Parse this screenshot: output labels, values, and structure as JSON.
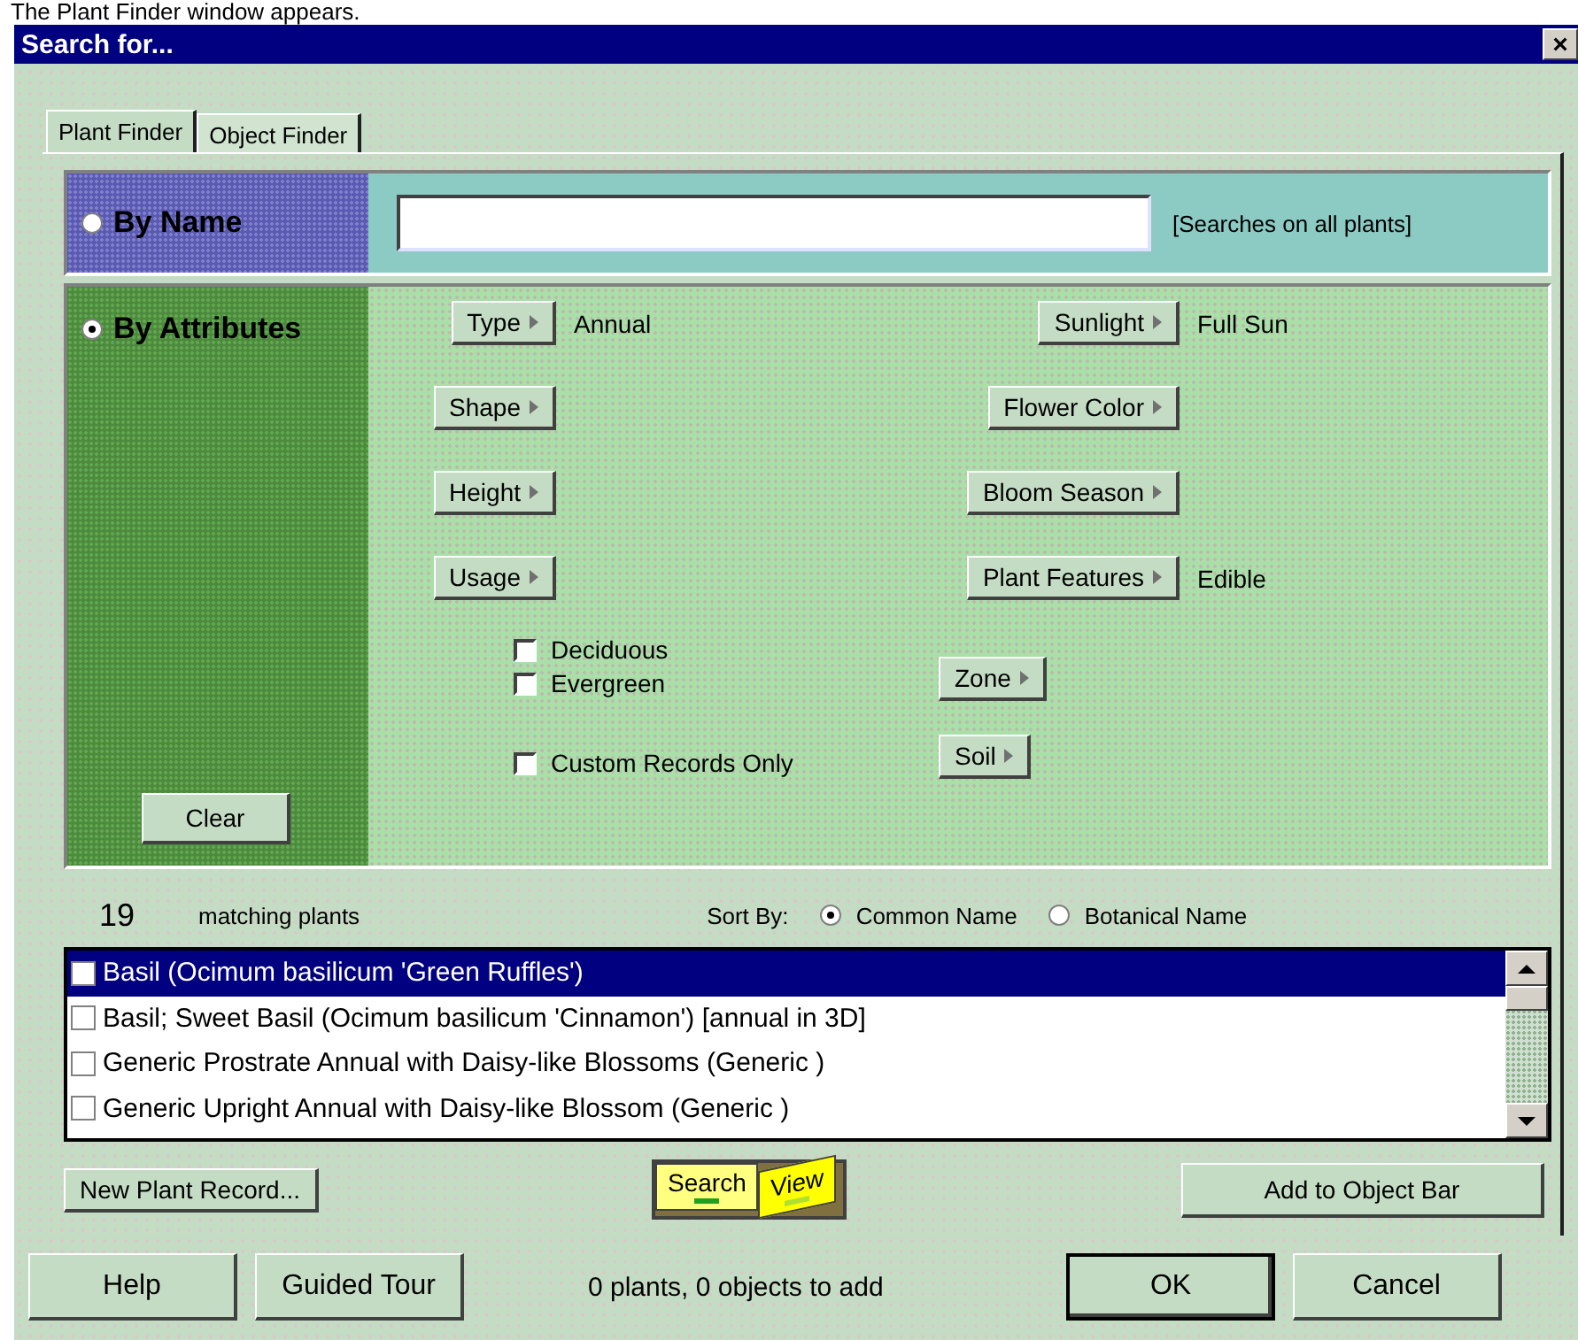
{
  "caption": "The Plant Finder window appears.",
  "window": {
    "title": "Search for...",
    "close": "×"
  },
  "tabs": [
    {
      "label": "Plant Finder",
      "selected": true
    },
    {
      "label": "Object Finder",
      "selected": false
    }
  ],
  "by_name": {
    "label": "By Name",
    "selected": false,
    "hint": "[Searches on all plants]"
  },
  "by_attributes": {
    "label": "By Attributes",
    "selected": true,
    "attributes": [
      {
        "label": "Type",
        "value": "Annual"
      },
      {
        "label": "Sunlight",
        "value": "Full Sun"
      },
      {
        "label": "Shape"
      },
      {
        "label": "Flower Color"
      },
      {
        "label": "Height"
      },
      {
        "label": "Bloom Season"
      },
      {
        "label": "Usage"
      },
      {
        "label": "Plant Features",
        "value": "Edible"
      }
    ],
    "checkboxes": [
      {
        "label": "Deciduous",
        "checked": false
      },
      {
        "label": "Evergreen",
        "checked": false
      },
      {
        "label": "Custom Records Only",
        "checked": false
      }
    ],
    "more_buttons": [
      "Zone",
      "Soil"
    ],
    "clear": "Clear"
  },
  "results": {
    "count": "19",
    "count_label": "matching plants",
    "sort_label": "Sort By:",
    "sort_options": [
      {
        "label": "Common Name",
        "selected": true
      },
      {
        "label": "Botanical Name",
        "selected": false
      }
    ]
  },
  "plants": [
    {
      "name": "Basil (Ocimum basilicum 'Green Ruffles')",
      "selected": true,
      "checked": false
    },
    {
      "name": "Basil; Sweet Basil (Ocimum basilicum 'Cinnamon') [annual in 3D]",
      "selected": false,
      "checked": false
    },
    {
      "name": "Generic Prostrate Annual with Daisy-like Blossoms (Generic )",
      "selected": false,
      "checked": false
    },
    {
      "name": "Generic Upright Annual with Daisy-like Blossom (Generic )",
      "selected": false,
      "checked": false
    }
  ],
  "actions": {
    "new_record": "New Plant Record...",
    "add": "Add to Object Bar"
  },
  "mode_tabs": [
    {
      "label": "Search",
      "selected": true
    },
    {
      "label": "View",
      "selected": false
    }
  ],
  "footer": {
    "buttons": [
      "Help",
      "Guided Tour"
    ],
    "status": "0 plants, 0 objects to add",
    "ok": "OK",
    "cancel": "Cancel"
  }
}
